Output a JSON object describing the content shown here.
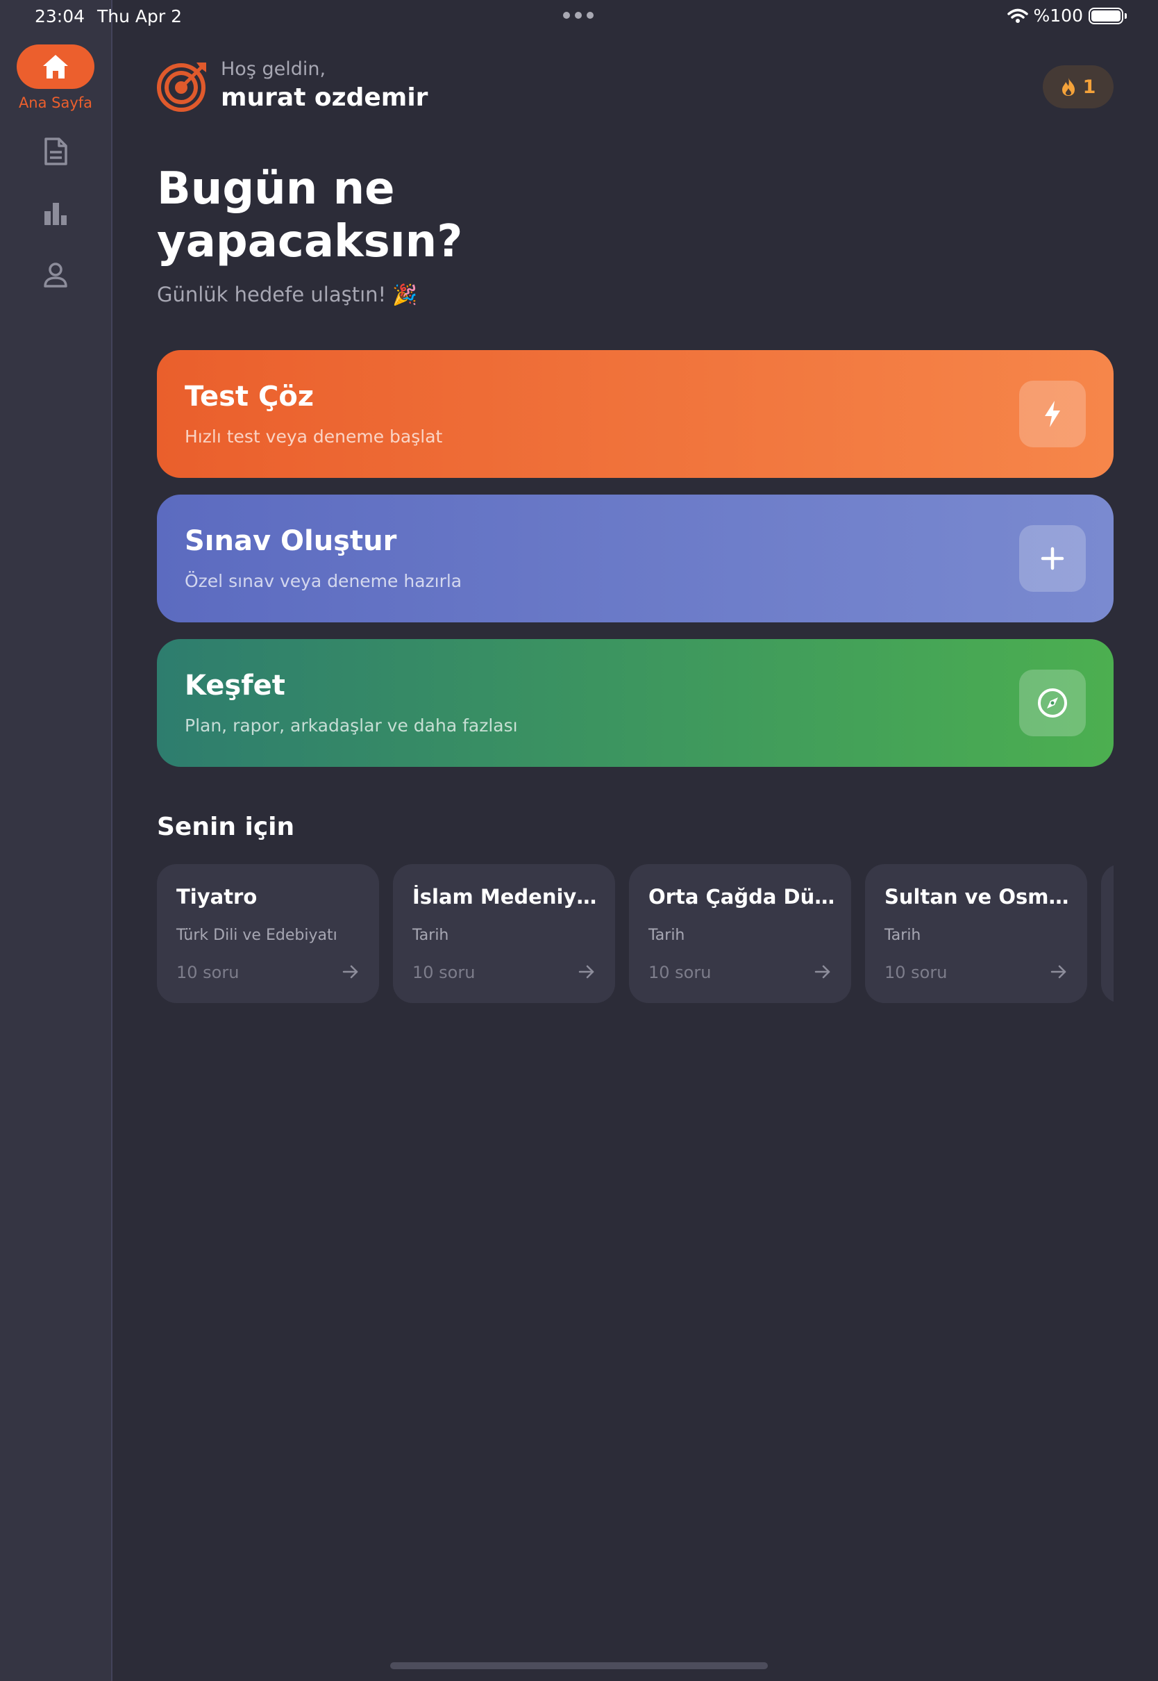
{
  "status_bar": {
    "time": "23:04",
    "date": "Thu Apr 2",
    "battery": "%100"
  },
  "sidebar": {
    "items": [
      {
        "label": "Ana Sayfa",
        "icon": "home-icon",
        "active": true
      },
      {
        "label": "",
        "icon": "document-icon",
        "active": false
      },
      {
        "label": "",
        "icon": "bar-chart-icon",
        "active": false
      },
      {
        "label": "",
        "icon": "person-icon",
        "active": false
      }
    ]
  },
  "header": {
    "greeting": "Hoş geldin,",
    "user_name": "murat ozdemir",
    "streak_count": "1"
  },
  "main": {
    "headline": "Bugün ne yapacaksın?",
    "subhead": "Günlük hedefe ulaştın! 🎉",
    "actions": [
      {
        "title": "Test Çöz",
        "subtitle": "Hızlı test veya deneme başlat",
        "icon": "lightning-icon"
      },
      {
        "title": "Sınav Oluştur",
        "subtitle": "Özel sınav veya deneme hazırla",
        "icon": "plus-icon"
      },
      {
        "title": "Keşfet",
        "subtitle": "Plan, rapor, arkadaşlar ve daha fazlası",
        "icon": "compass-icon"
      }
    ],
    "section_title": "Senin için",
    "recommendations": [
      {
        "title": "Tiyatro",
        "subject": "Türk Dili ve Edebiyatı",
        "count": "10 soru"
      },
      {
        "title": "İslam Medeniyeti'nin Doğuşu",
        "subject": "Tarih",
        "count": "10 soru"
      },
      {
        "title": "Orta Çağda Dünya",
        "subject": "Tarih",
        "count": "10 soru"
      },
      {
        "title": "Sultan ve Osmanlı Merkez Teşkilatı",
        "subject": "Tarih",
        "count": "10 soru"
      }
    ]
  },
  "colors": {
    "accent": "#ec5f2d",
    "background": "#2c2c38",
    "sidebar": "#353543",
    "card": "#383847",
    "streak": "#f4a23a"
  }
}
